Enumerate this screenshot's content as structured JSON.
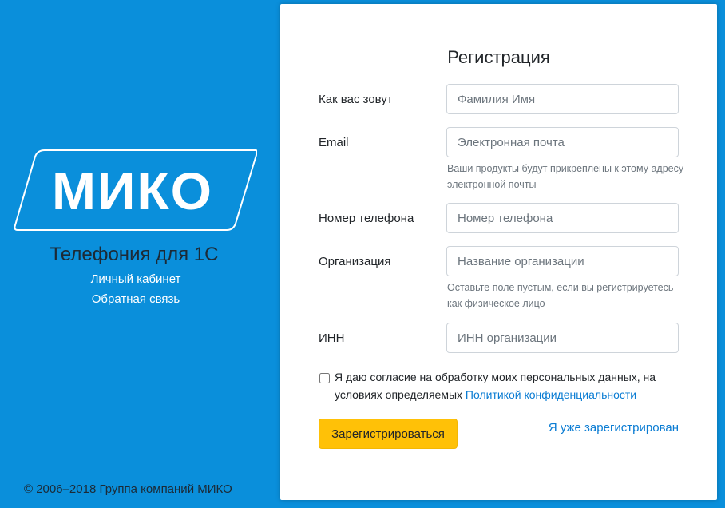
{
  "brand": {
    "logo_text": "МИКО",
    "tagline": "Телефония для 1С",
    "links": [
      {
        "label": "Личный кабинет"
      },
      {
        "label": "Обратная связь"
      }
    ],
    "copyright": "© 2006–2018 Группа компаний МИКО"
  },
  "form": {
    "title": "Регистрация",
    "fields": [
      {
        "label": "Как вас зовут",
        "placeholder": "Фамилия Имя",
        "value": ""
      },
      {
        "label": "Email",
        "placeholder": "Электронная почта",
        "value": "",
        "help": "Ваши продукты будут прикреплены к этому адресу электронной почты"
      },
      {
        "label": "Номер телефона",
        "placeholder": "Номер телефона",
        "value": ""
      },
      {
        "label": "Организация",
        "placeholder": "Название организации",
        "value": "",
        "help": "Оставьте поле пустым, если вы регистрируетесь как физическое лицо"
      },
      {
        "label": "ИНН",
        "placeholder": "ИНН организации",
        "value": ""
      }
    ],
    "consent": {
      "checked": false,
      "text": "Я даю согласие на обработку моих персональных данных, на условиях определяемых ",
      "link": "Политикой конфиденциальности"
    },
    "submit_label": "Зарегистрироваться",
    "already_label": "Я уже зарегистрирован"
  },
  "colors": {
    "background": "#0a8fdb",
    "accent_button": "#ffc107",
    "link": "#0a7cd3"
  }
}
